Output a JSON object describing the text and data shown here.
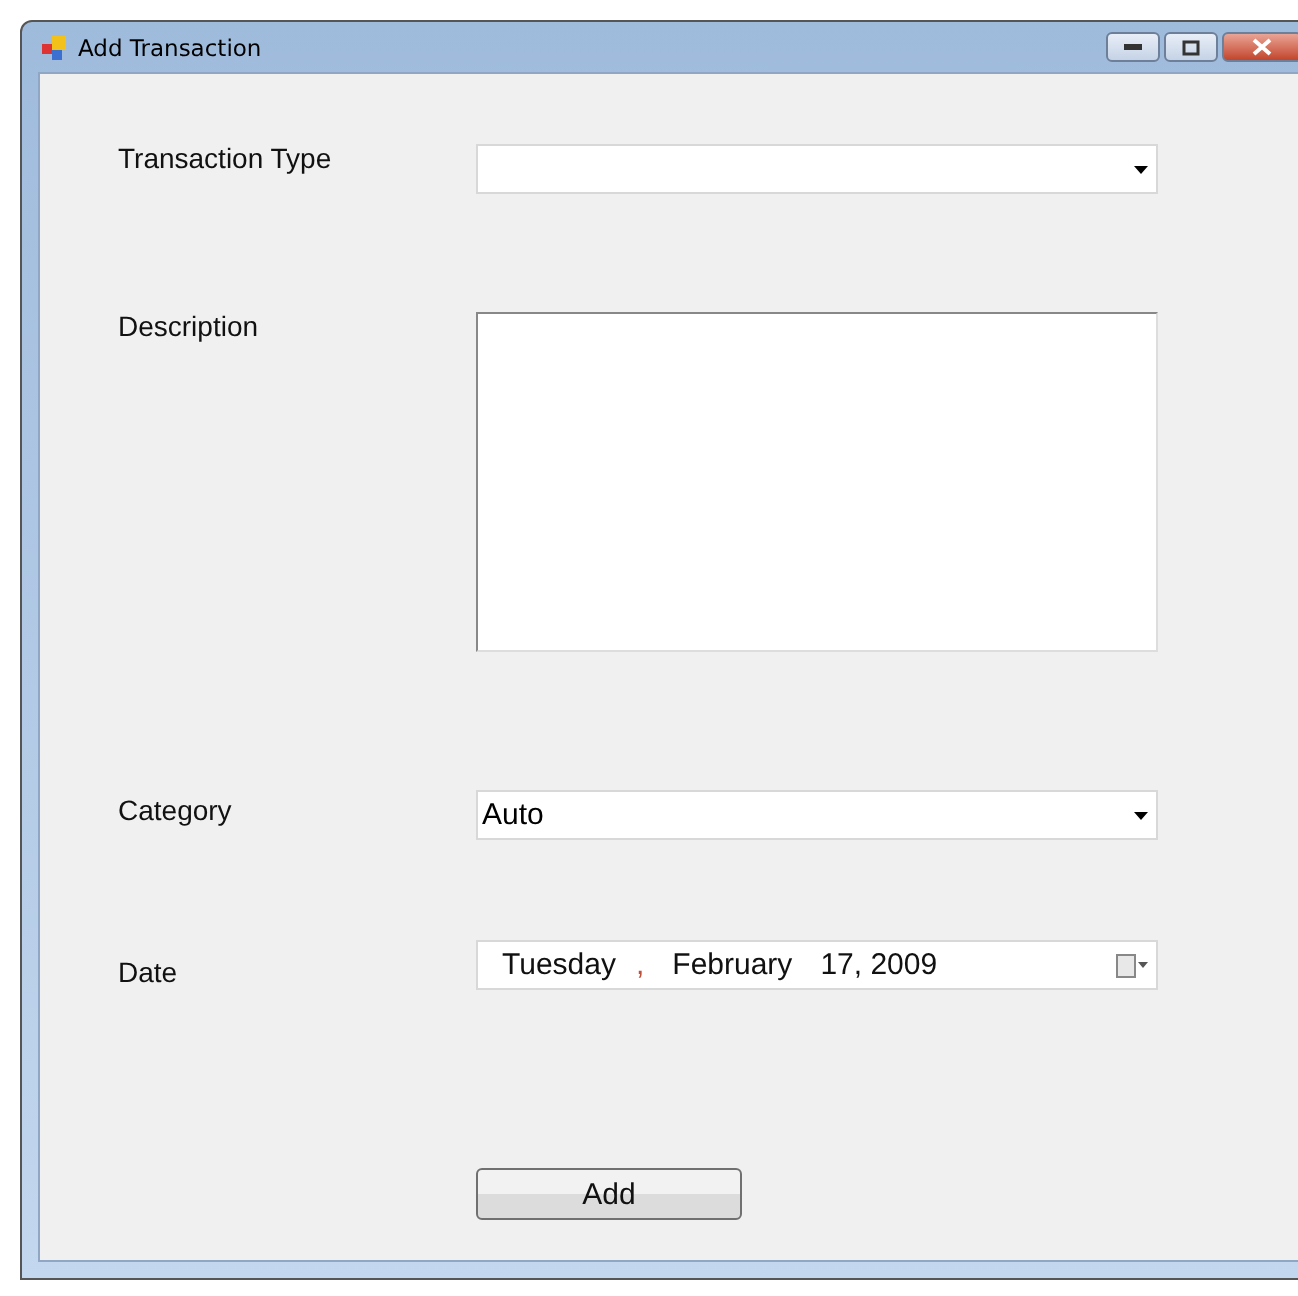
{
  "window": {
    "title": "Add Transaction"
  },
  "fields": [
    {
      "kind": "combo",
      "label": "Transaction Type"
    },
    {
      "kind": "textarea",
      "label": "Description"
    },
    {
      "kind": "combo",
      "label": "Category",
      "value": "Auto"
    },
    {
      "kind": "date",
      "label": "Date",
      "weekday": "Tuesday",
      "separator": ",",
      "month": "February",
      "day_year": "17, 2009"
    }
  ],
  "buttons": [
    "Add"
  ]
}
